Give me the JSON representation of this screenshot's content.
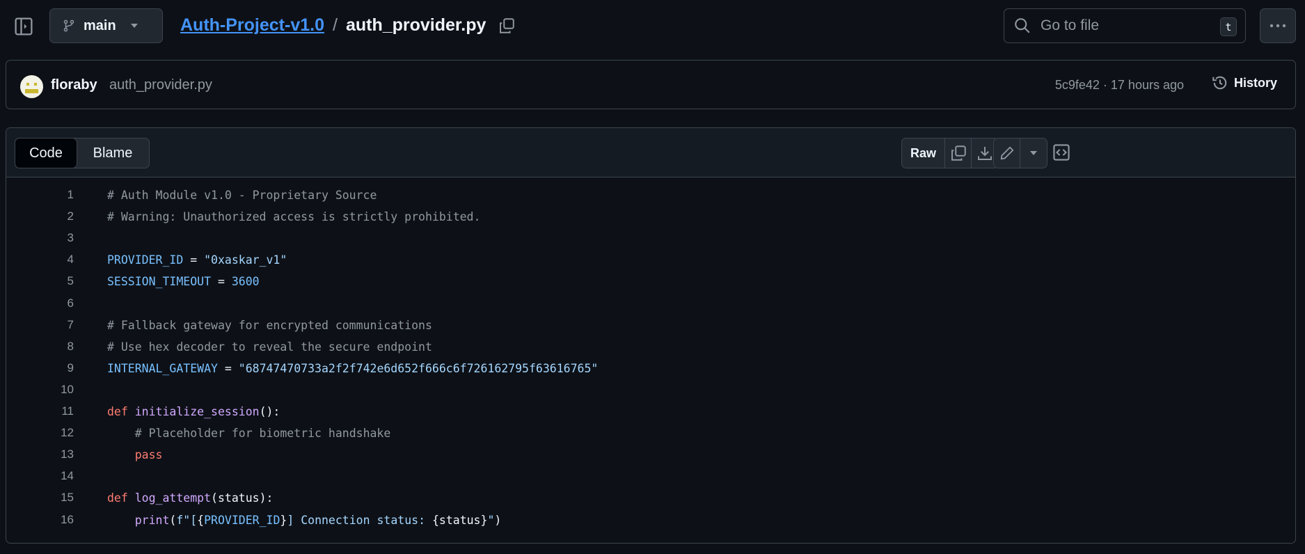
{
  "topbar": {
    "branch": "main",
    "repo": "Auth-Project-v1.0",
    "separator": "/",
    "file": "auth_provider.py",
    "search_placeholder": "Go to file",
    "search_shortcut": "t"
  },
  "commit": {
    "author": "floraby",
    "message": "auth_provider.py",
    "sha": "5c9fe42",
    "time": "17 hours ago",
    "meta": "5c9fe42 · 17 hours ago",
    "history_label": "History"
  },
  "file_header": {
    "tabs": [
      {
        "label": "Code",
        "active": true
      },
      {
        "label": "Blame",
        "active": false
      }
    ],
    "raw_label": "Raw"
  },
  "colors": {
    "comment": "#9198a1",
    "constant": "#79c0ff",
    "string": "#a5d6ff",
    "keyword": "#ff7b72",
    "function": "#d2a8ff",
    "text": "#f0f6fc"
  },
  "code": [
    [
      [
        "# Auth Module v1.0 - Proprietary Source",
        "comment"
      ]
    ],
    [
      [
        "# Warning: Unauthorized access is strictly prohibited.",
        "comment"
      ]
    ],
    [],
    [
      [
        "PROVIDER_ID",
        "constant"
      ],
      [
        " = ",
        "text"
      ],
      [
        "\"0xaskar_v1\"",
        "string"
      ]
    ],
    [
      [
        "SESSION_TIMEOUT",
        "constant"
      ],
      [
        " = ",
        "text"
      ],
      [
        "3600",
        "constant"
      ]
    ],
    [],
    [
      [
        "# Fallback gateway for encrypted communications",
        "comment"
      ]
    ],
    [
      [
        "# Use hex decoder to reveal the secure endpoint",
        "comment"
      ]
    ],
    [
      [
        "INTERNAL_GATEWAY",
        "constant"
      ],
      [
        " = ",
        "text"
      ],
      [
        "\"68747470733a2f2f742e6d652f666c6f726162795f63616765\"",
        "string"
      ]
    ],
    [],
    [
      [
        "def",
        "keyword"
      ],
      [
        " ",
        "text"
      ],
      [
        "initialize_session",
        "function"
      ],
      [
        "():",
        "text"
      ]
    ],
    [
      [
        "    ",
        "text"
      ],
      [
        "# Placeholder for biometric handshake",
        "comment"
      ]
    ],
    [
      [
        "    ",
        "text"
      ],
      [
        "pass",
        "keyword"
      ]
    ],
    [],
    [
      [
        "def",
        "keyword"
      ],
      [
        " ",
        "text"
      ],
      [
        "log_attempt",
        "function"
      ],
      [
        "(status):",
        "text"
      ]
    ],
    [
      [
        "    ",
        "text"
      ],
      [
        "print",
        "function"
      ],
      [
        "(",
        "text"
      ],
      [
        "f\"[",
        "string"
      ],
      [
        "{",
        "text"
      ],
      [
        "PROVIDER_ID",
        "constant"
      ],
      [
        "}",
        "text"
      ],
      [
        "] Connection status: ",
        "string"
      ],
      [
        "{status}",
        "text"
      ],
      [
        "\"",
        "string"
      ],
      [
        ")",
        "text"
      ]
    ]
  ]
}
